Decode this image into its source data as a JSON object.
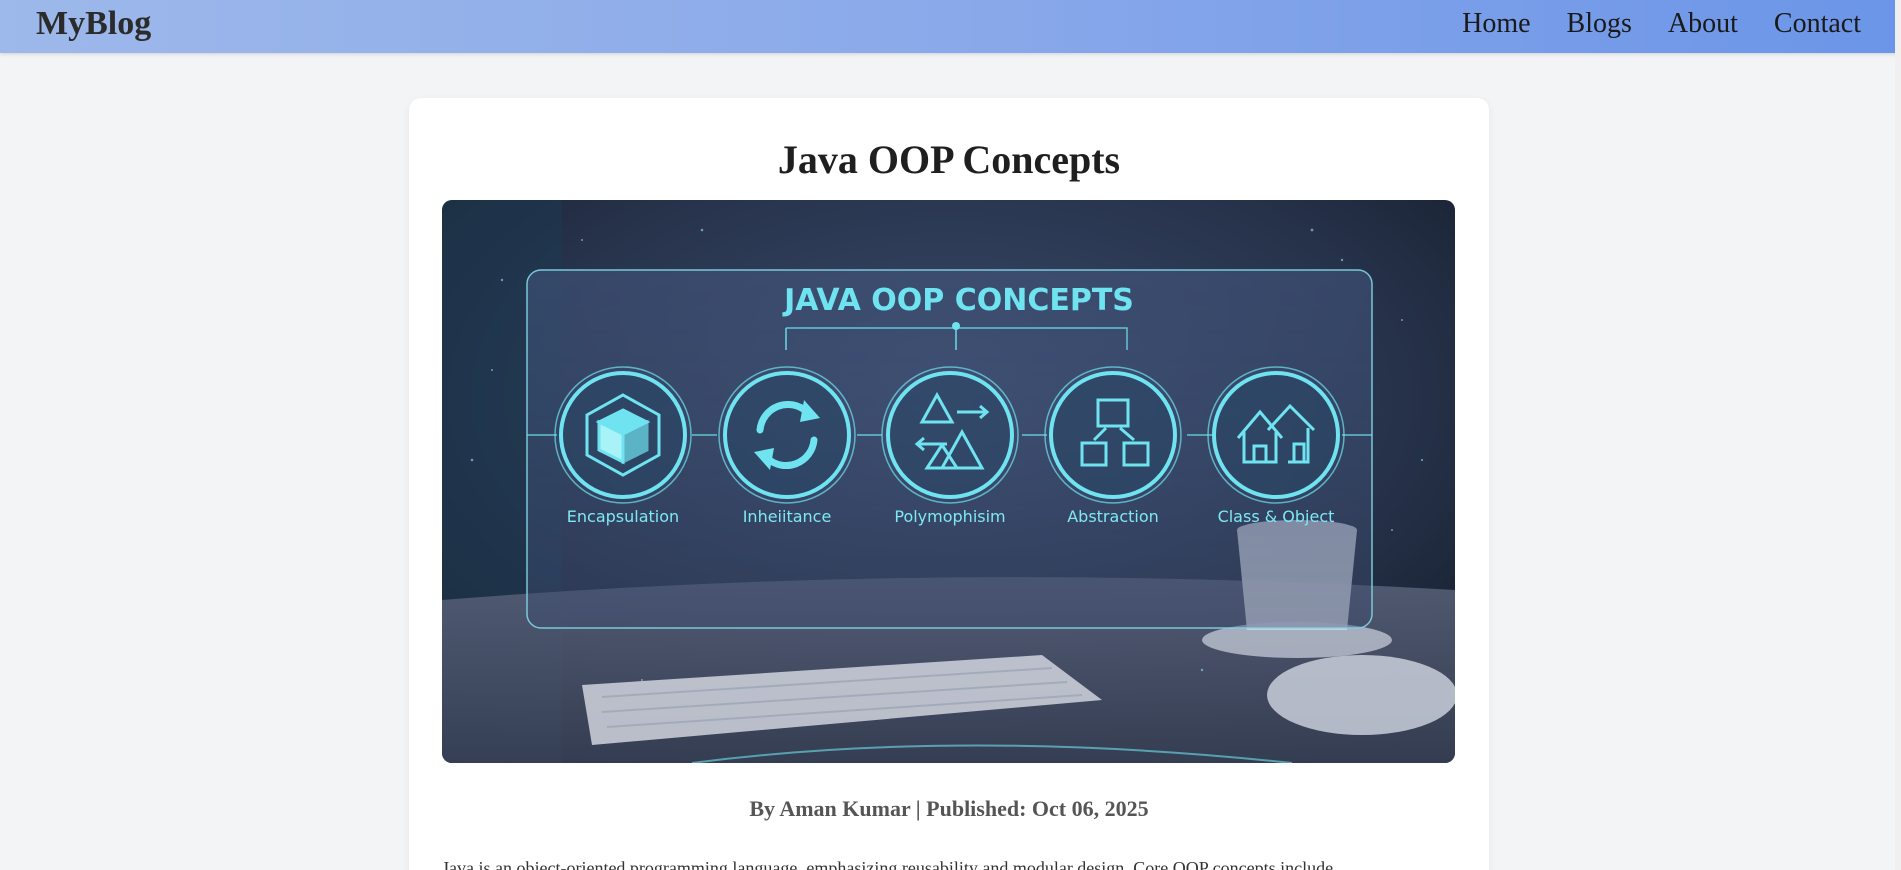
{
  "nav": {
    "brand": "MyBlog",
    "links": [
      "Home",
      "Blogs",
      "About",
      "Contact"
    ]
  },
  "post": {
    "title": "Java OOP Concepts",
    "meta": "By Aman Kumar | Published: Oct 06, 2025",
    "excerpt": "Java is an object-oriented programming language, emphasizing reusability and modular design. Core OOP concepts include",
    "image": {
      "heading": "JAVA OOP CONCEPTS",
      "concepts": [
        {
          "label": "Encapsulation",
          "icon": "cube-icon"
        },
        {
          "label": "Inheiitance",
          "icon": "cycle-arrows-icon"
        },
        {
          "label": "Polymophisim",
          "icon": "shapes-arrows-icon"
        },
        {
          "label": "Abstraction",
          "icon": "cubes-network-icon"
        },
        {
          "label": "Class & Object",
          "icon": "houses-icon"
        }
      ]
    }
  },
  "colors": {
    "nav_gradient_start": "#9db8ea",
    "nav_gradient_end": "#6b95e8",
    "hero_accent": "#6fe3f0"
  }
}
